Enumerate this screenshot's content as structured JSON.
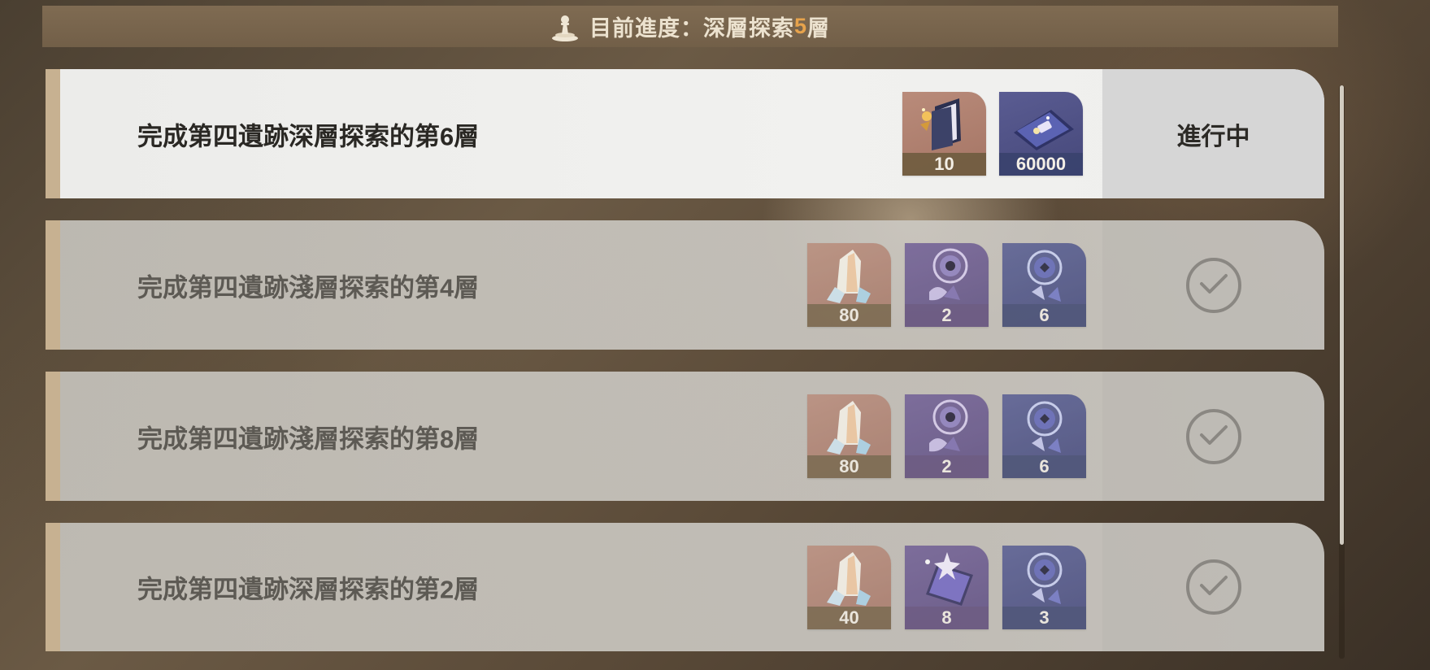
{
  "progress": {
    "label": "目前進度：深層探索",
    "value": "5",
    "suffix": "層"
  },
  "tasks": [
    {
      "title": "完成第四遺跡深層探索的第6層",
      "status": "進行中",
      "rewards": [
        {
          "icon": "book-icon",
          "count": "10"
        },
        {
          "icon": "card-icon",
          "count": "60000"
        }
      ]
    },
    {
      "title": "完成第四遺跡淺層探索的第4層",
      "status": "completed",
      "rewards": [
        {
          "icon": "crystal-icon",
          "count": "80"
        },
        {
          "icon": "dreamcatcher-icon",
          "count": "2"
        },
        {
          "icon": "dreamcatcher-icon",
          "count": "6"
        }
      ]
    },
    {
      "title": "完成第四遺跡淺層探索的第8層",
      "status": "completed",
      "rewards": [
        {
          "icon": "crystal-icon",
          "count": "80"
        },
        {
          "icon": "dreamcatcher-icon",
          "count": "2"
        },
        {
          "icon": "dreamcatcher-icon",
          "count": "6"
        }
      ]
    },
    {
      "title": "完成第四遺跡深層探索的第2層",
      "status": "completed",
      "rewards": [
        {
          "icon": "crystal-icon",
          "count": "40"
        },
        {
          "icon": "ticket-icon",
          "count": "8"
        },
        {
          "icon": "dreamcatcher-icon",
          "count": "3"
        }
      ]
    }
  ],
  "colors": {
    "accent_highlight": "#e7a34c",
    "header_bg": "#7a664d",
    "row_accent": "#c7b191"
  }
}
